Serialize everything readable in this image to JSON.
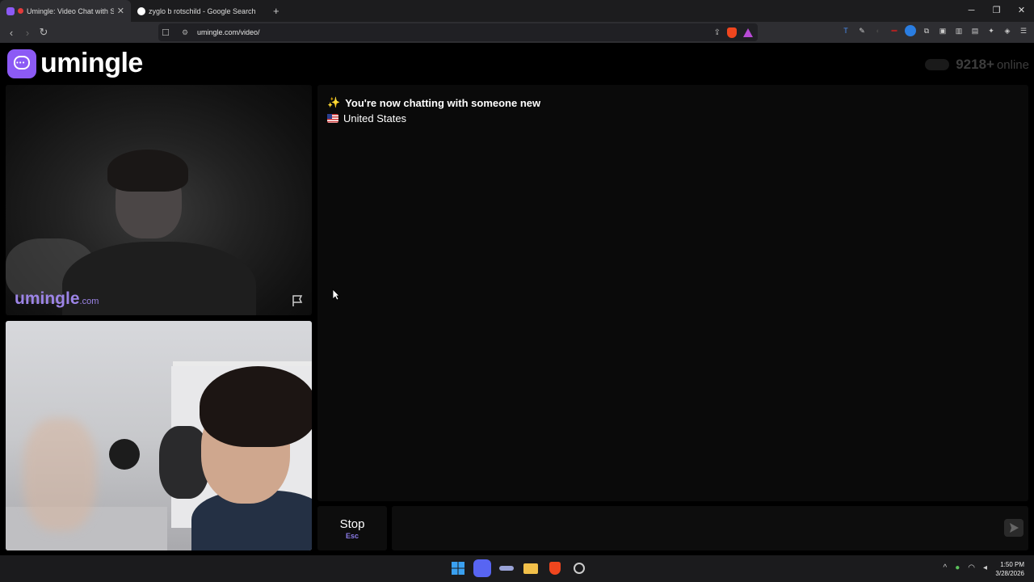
{
  "browser": {
    "tabs": [
      {
        "title": "Umingle: Video Chat with Str",
        "active": true,
        "favicon_color": "#8c5af5"
      },
      {
        "title": "zyglo b rotschild - Google Search",
        "active": false,
        "favicon_color": "#ffffff"
      }
    ],
    "url": "umingle.com/video/",
    "window_controls": {
      "minimize": "─",
      "restore": "❐",
      "close": "✕"
    }
  },
  "header": {
    "logo_text": "umingle",
    "online_count": "9218+",
    "online_label": "online"
  },
  "remote_video": {
    "watermark_main": "umingle",
    "watermark_suffix": ".com"
  },
  "chat": {
    "status_message": "You're now chatting with someone new",
    "country": "United States",
    "accent_color": "#8c5af5"
  },
  "controls": {
    "stop_label": "Stop",
    "stop_shortcut": "Esc",
    "message_placeholder": ""
  },
  "taskbar": {
    "time": "1:50 PM",
    "date": "3/28/2026"
  }
}
